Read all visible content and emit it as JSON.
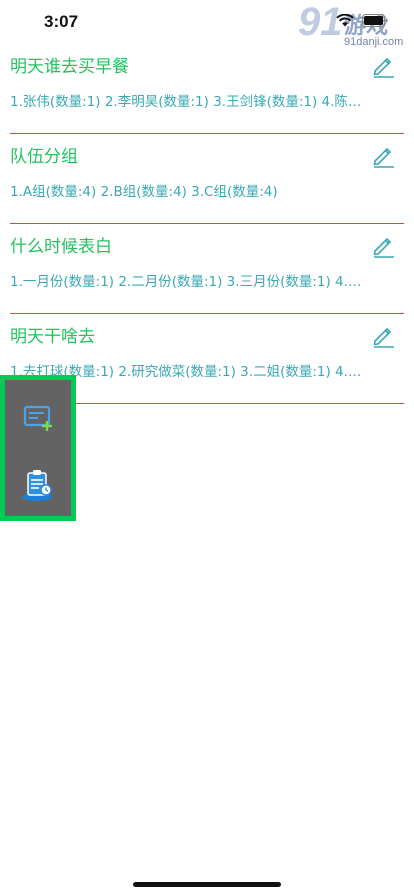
{
  "status_bar": {
    "time": "3:07"
  },
  "watermark": {
    "number": "91",
    "word": "游戏",
    "url": "91danji.com"
  },
  "groups": [
    {
      "title": "明天谁去买早餐",
      "members": "1.张伟(数量:1)  2.李明昊(数量:1)  3.王剑锋(数量:1)  4.陈…"
    },
    {
      "title": "队伍分组",
      "members": "1.A组(数量:4)  2.B组(数量:4)  3.C组(数量:4)"
    },
    {
      "title": "什么时候表白",
      "members": "1.一月份(数量:1)  2.二月份(数量:1)  3.三月份(数量:1)  4.…"
    },
    {
      "title": "明天干啥去",
      "members": "1.去打球(数量:1)  2.研究做菜(数量:1)  3.二姐(数量:1)  4.…"
    }
  ],
  "icons": {
    "edit": "pencil-icon",
    "add": "add-note-icon",
    "clipboard": "clipboard-icon",
    "wifi": "wifi-icon",
    "battery": "battery-icon"
  },
  "colors": {
    "title": "#22c35e",
    "members": "#3aa8b4",
    "divider": "#e0443e",
    "fab_border": "#00cc55",
    "fab_bg": "#636363"
  }
}
